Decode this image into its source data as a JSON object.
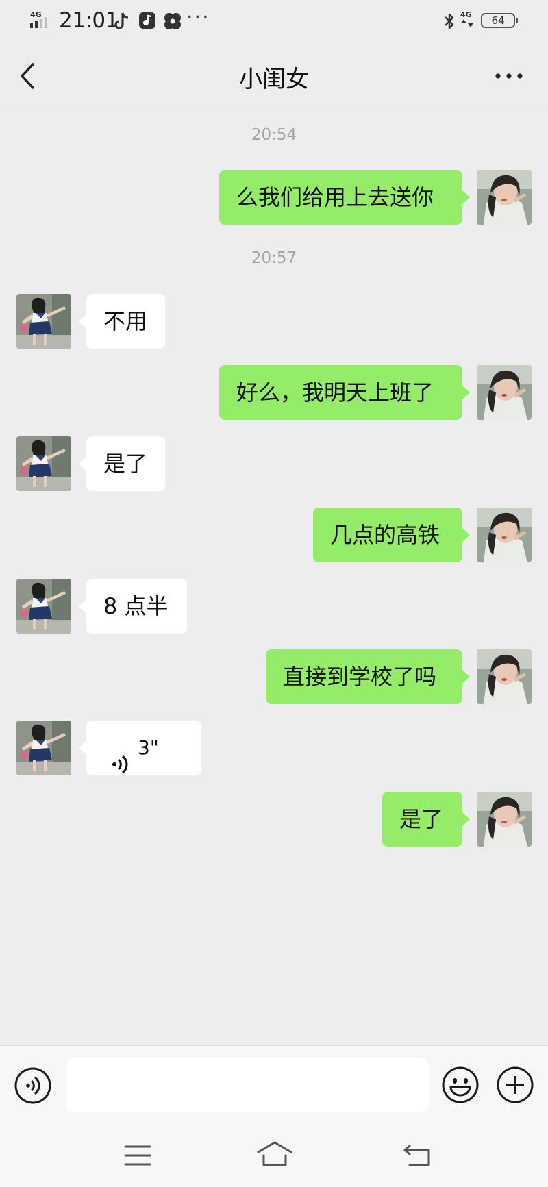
{
  "status_bar": {
    "time": "21:01",
    "network_left": "4G",
    "network_right": "4G",
    "battery": "64",
    "more": "···",
    "icons": [
      "signal-icon",
      "tiktok-icon",
      "music-app-icon",
      "pinwheel-icon",
      "bluetooth-icon"
    ]
  },
  "nav": {
    "title": "小闺女",
    "back_icon": "chevron-left-icon",
    "more_icon": "more-dots-icon"
  },
  "messages": [
    {
      "type": "timestamp",
      "text": "20:54"
    },
    {
      "type": "text",
      "side": "out",
      "text": "么我们给用上去送你"
    },
    {
      "type": "timestamp",
      "text": "20:57"
    },
    {
      "type": "text",
      "side": "in",
      "text": "不用"
    },
    {
      "type": "text",
      "side": "out",
      "text": "好么，我明天上班了"
    },
    {
      "type": "text",
      "side": "in",
      "text": "是了"
    },
    {
      "type": "text",
      "side": "out",
      "text": "几点的高铁"
    },
    {
      "type": "text",
      "side": "in",
      "text": "8 点半"
    },
    {
      "type": "text",
      "side": "out",
      "text": "直接到学校了吗"
    },
    {
      "type": "voice",
      "side": "in",
      "duration": "3\""
    },
    {
      "type": "text",
      "side": "out",
      "text": "是了"
    }
  ],
  "input_bar": {
    "placeholder": "",
    "voice_icon": "voice-toggle-icon",
    "emoji_icon": "smiley-icon",
    "add_icon": "plus-circle-icon"
  },
  "system_nav": {
    "icons": [
      "menu-icon",
      "home-icon",
      "back-icon"
    ]
  },
  "colors": {
    "background": "#ededed",
    "outgoing_bubble": "#95ec69",
    "incoming_bubble": "#ffffff",
    "timestamp_text": "#a3a3a3"
  }
}
